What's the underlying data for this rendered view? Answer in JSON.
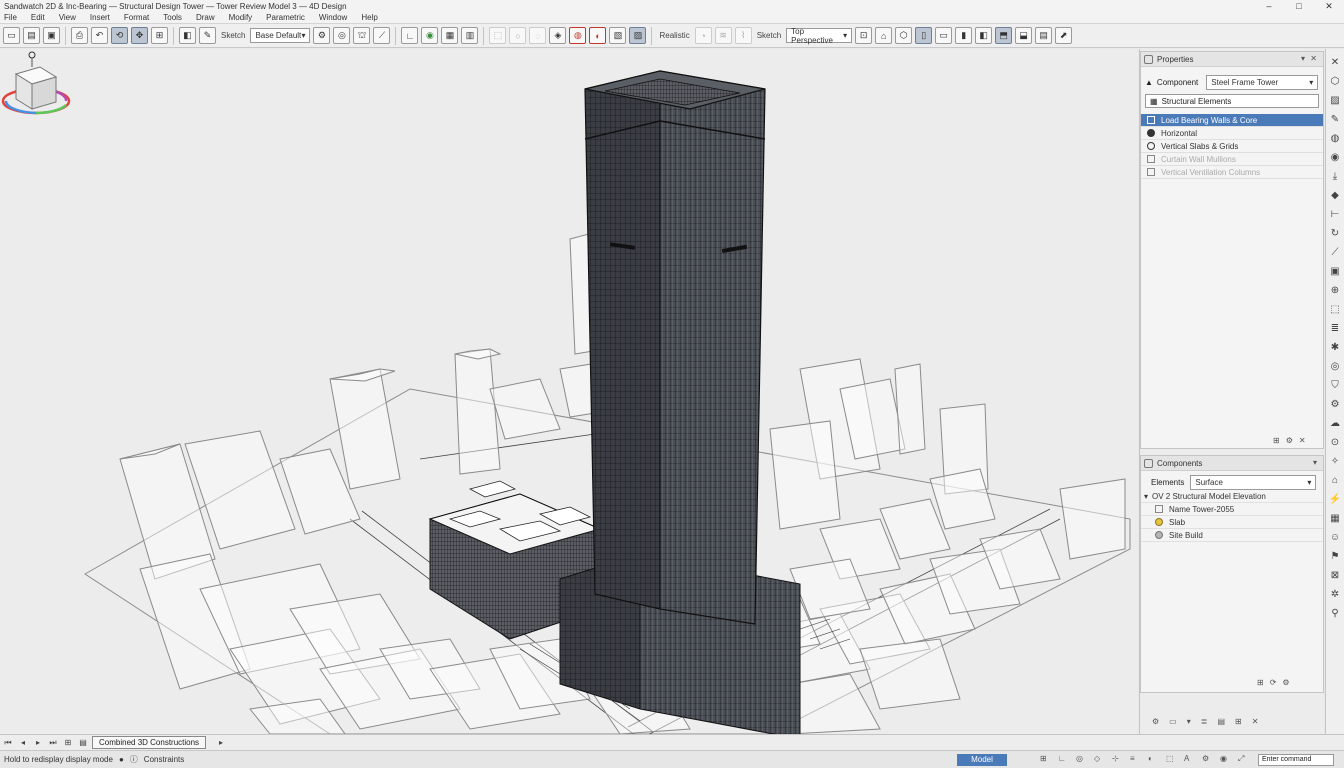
{
  "window": {
    "title": "Sandwatch 2D & Inc-Bearing — Structural Design Tower — Tower Review Model 3 — 4D Design",
    "controls": [
      "–",
      "□",
      "✕"
    ]
  },
  "menu": [
    "File",
    "Edit",
    "View",
    "Insert",
    "Format",
    "Tools",
    "Draw",
    "Modify",
    "Parametric",
    "Window",
    "Help"
  ],
  "toolbar": {
    "style_dropdown": "Sketch",
    "style_dropdown_label": "Sketch",
    "layer_dropdown": "Base Default",
    "render_label": "Realistic",
    "view_dropdown": "Top Perspective",
    "accent_color": "#4a7ab8",
    "highlight_color": "#c0392b"
  },
  "panel_top": {
    "title": "Properties",
    "dropdown_label": "Component",
    "dropdown_value": "Steel Frame Tower",
    "search_placeholder": "Structural Elements",
    "items": [
      {
        "label": "Load Bearing Walls & Core",
        "selected": true,
        "dim": false,
        "icon": "grid-icon"
      },
      {
        "label": "Horizontal",
        "selected": false,
        "dim": false,
        "icon": "radio-filled-icon"
      },
      {
        "label": "Vertical Slabs & Grids",
        "selected": false,
        "dim": false,
        "icon": "radio-icon"
      },
      {
        "label": "Curtain Wall Mullions",
        "selected": false,
        "dim": true,
        "icon": "grid-icon"
      },
      {
        "label": "Vertical Ventilation Columns",
        "selected": false,
        "dim": true,
        "icon": "grid-icon"
      }
    ]
  },
  "panel_bottom": {
    "title": "Components",
    "filter_label": "Elements",
    "filter_value": "Surface",
    "tree_root": "OV  2  Structural Model Elevation",
    "rows": [
      {
        "label": "Name    Tower-2055",
        "icon": "table-icon"
      },
      {
        "label": "Slab",
        "icon": "yellow-dot-icon"
      },
      {
        "label": "Site Build",
        "icon": "gray-dot-icon"
      }
    ]
  },
  "tabbar": {
    "active_tab": "Combined 3D Constructions",
    "arrow": "▸"
  },
  "status": {
    "left_text": "Hold to redisplay display mode",
    "mode_text": "Constraints",
    "highlight_text": "Model",
    "command_placeholder": "Enter command"
  },
  "viewcube": {
    "face": "TOP",
    "ring_colors": [
      "#e0443c",
      "#4a90e2",
      "#5ac85a",
      "#e6c53c",
      "#b84ab8"
    ]
  }
}
